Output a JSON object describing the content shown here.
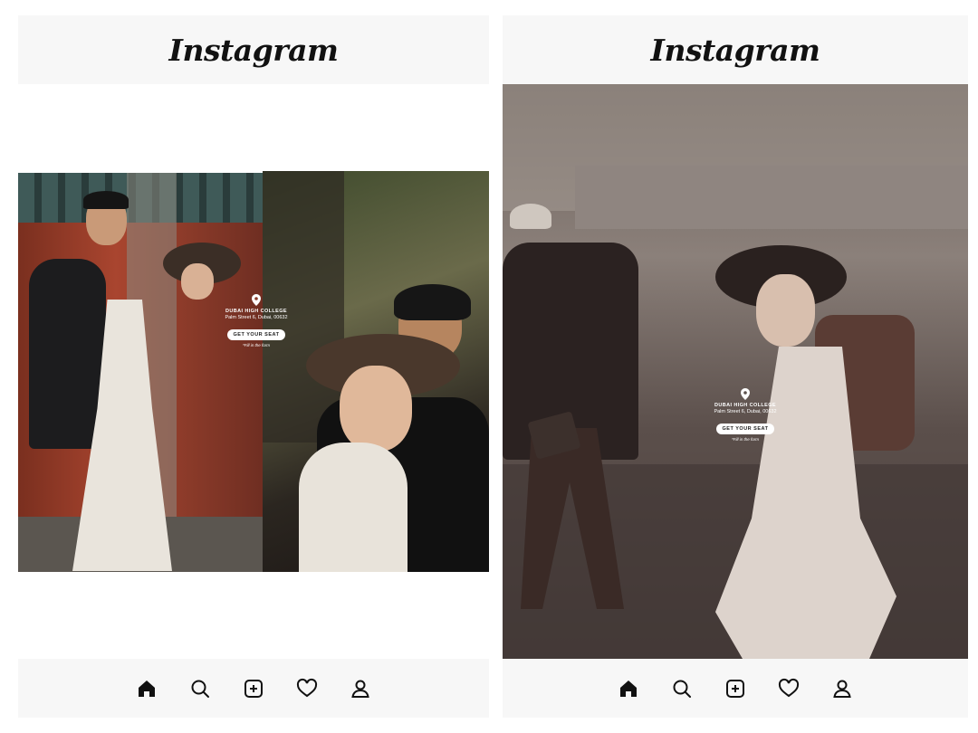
{
  "screens": [
    {
      "app_title": "Instagram",
      "ad": {
        "title": "DUBAI HIGH COLLEGE",
        "address": "Palm Street 6, Dubai, 00632",
        "cta": "GET YOUR SEAT",
        "note": "*Fill in the form"
      },
      "nav": [
        "home-icon",
        "search-icon",
        "add-post-icon",
        "heart-icon",
        "profile-icon"
      ]
    },
    {
      "app_title": "Instagram",
      "ad": {
        "title": "DUBAI HIGH COLLEGE",
        "address": "Palm Street 6, Dubai, 00632",
        "cta": "GET YOUR SEAT",
        "note": "*Fill in the form"
      },
      "nav": [
        "home-icon",
        "search-icon",
        "add-post-icon",
        "heart-icon",
        "profile-icon"
      ]
    }
  ]
}
